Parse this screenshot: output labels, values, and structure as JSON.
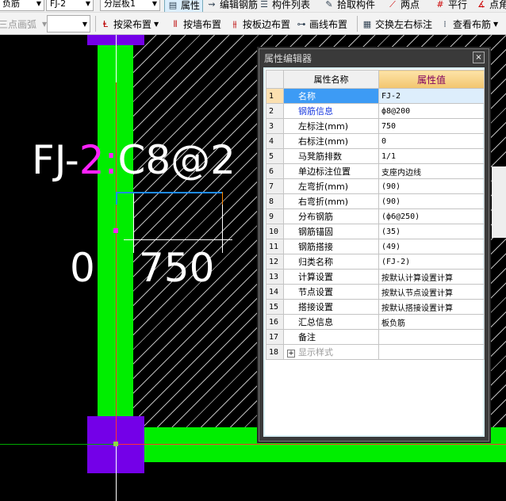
{
  "toolbar1": {
    "combo1": "负筋",
    "combo2": "FJ-2",
    "combo3": "分层板1",
    "properties": "属性",
    "edit_rebar": "编辑钢筋",
    "component_list": "构件列表",
    "pick_component": "拾取构件",
    "grid_point": "两点",
    "parallel": "平行",
    "point_angle": "点角"
  },
  "toolbar2": {
    "arc": "三点画弧",
    "combo": "",
    "by_beam": "按梁布置",
    "by_wall": "按墙布置",
    "by_slab_edge": "按板边布置",
    "by_line": "画线布置",
    "swap_labels": "交换左右标注",
    "view_rebar": "查看布筋"
  },
  "canvas": {
    "label_main": "FJ-",
    "label_mid": "2:",
    "label_rest": "C8@2",
    "left_dim": "0",
    "right_dim": "750",
    "colors": {
      "wall": "#00ee00",
      "column": "#7400e8",
      "highlight": "#ff22ff"
    }
  },
  "dialog": {
    "title": "属性编辑器",
    "close": "×",
    "col_name": "属性名称",
    "col_value": "属性值",
    "rows": [
      {
        "n": "1",
        "name": "名称",
        "value": "FJ-2"
      },
      {
        "n": "2",
        "name": "钢筋信息",
        "value": "ф8@200"
      },
      {
        "n": "3",
        "name": "左标注(mm)",
        "value": "750"
      },
      {
        "n": "4",
        "name": "右标注(mm)",
        "value": "0"
      },
      {
        "n": "5",
        "name": "马凳筋排数",
        "value": "1/1"
      },
      {
        "n": "6",
        "name": "单边标注位置",
        "value": "支座内边线"
      },
      {
        "n": "7",
        "name": "左弯折(mm)",
        "value": "(90)"
      },
      {
        "n": "8",
        "name": "右弯折(mm)",
        "value": "(90)"
      },
      {
        "n": "9",
        "name": "分布钢筋",
        "value": "(ф6@250)"
      },
      {
        "n": "10",
        "name": "钢筋锚固",
        "value": "(35)"
      },
      {
        "n": "11",
        "name": "钢筋搭接",
        "value": "(49)"
      },
      {
        "n": "12",
        "name": "归类名称",
        "value": "(FJ-2)"
      },
      {
        "n": "13",
        "name": "计算设置",
        "value": "按默认计算设置计算"
      },
      {
        "n": "14",
        "name": "节点设置",
        "value": "按默认节点设置计算"
      },
      {
        "n": "15",
        "name": "搭接设置",
        "value": "按默认搭接设置计算"
      },
      {
        "n": "16",
        "name": "汇总信息",
        "value": "板负筋"
      },
      {
        "n": "17",
        "name": "备注",
        "value": ""
      },
      {
        "n": "18",
        "name": "显示样式",
        "value": ""
      }
    ]
  }
}
